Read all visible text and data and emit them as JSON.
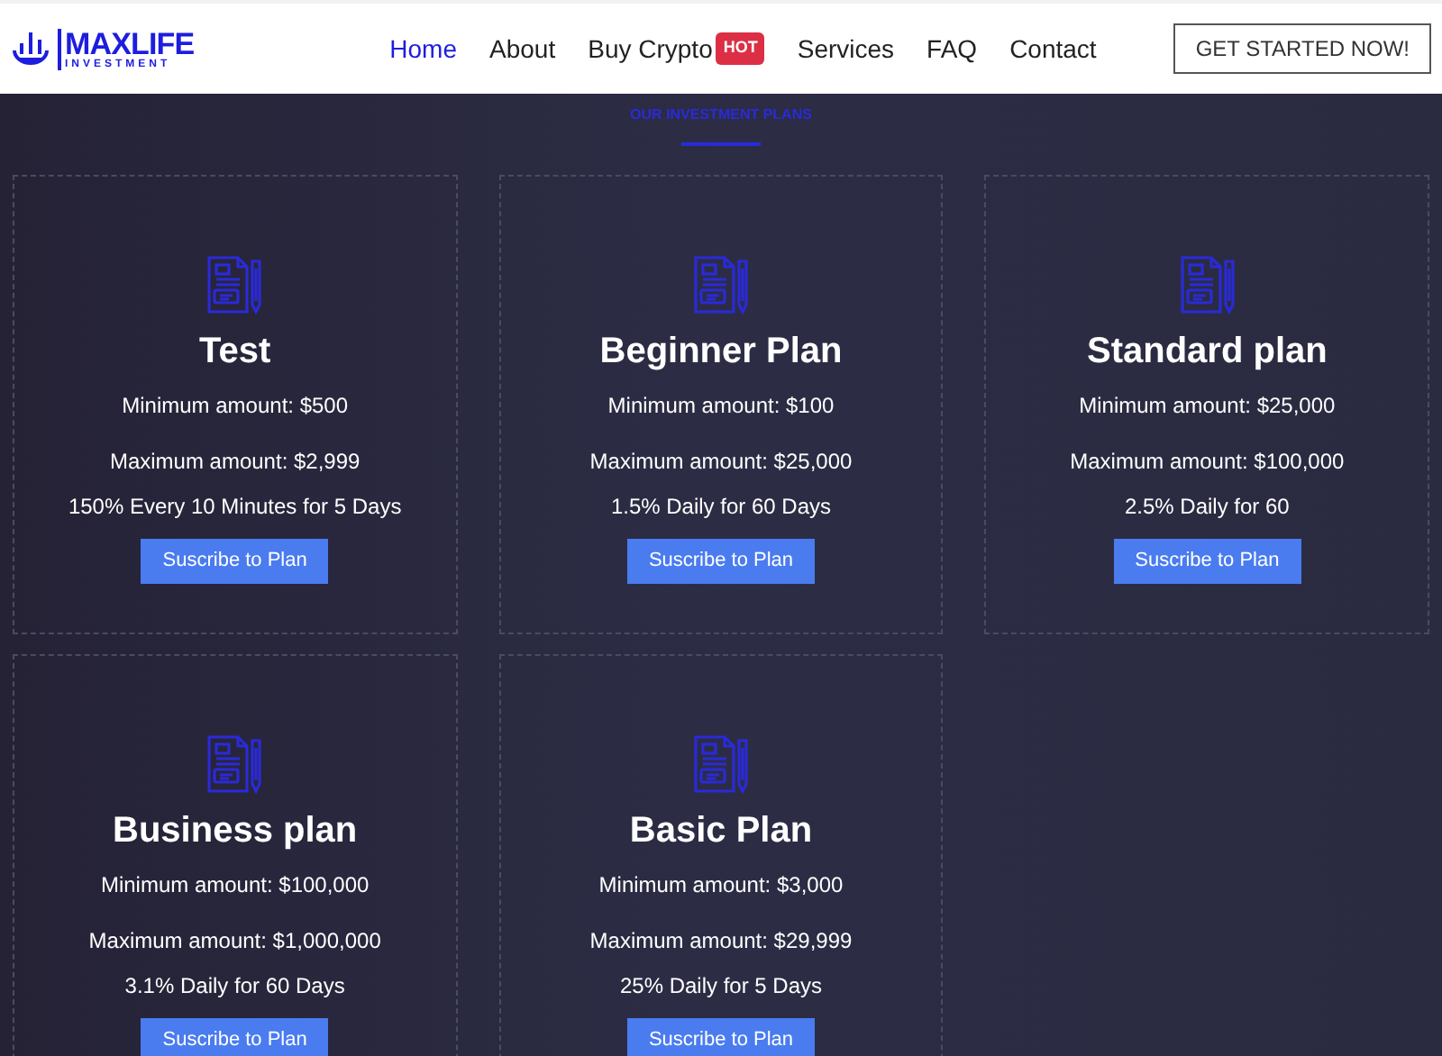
{
  "logo": {
    "name": "MAXLIFE",
    "tagline": "INVESTMENT"
  },
  "nav": [
    {
      "label": "Home",
      "selected": true
    },
    {
      "label": "About",
      "selected": false
    },
    {
      "label": "Buy Crypto",
      "selected": false,
      "badge": "HOT"
    },
    {
      "label": "Services",
      "selected": false
    },
    {
      "label": "FAQ",
      "selected": false
    },
    {
      "label": "Contact",
      "selected": false
    }
  ],
  "cta": "GET STARTED NOW!",
  "section_title": "OUR INVESTMENT PLANS",
  "plans": [
    {
      "name": "Test",
      "min": "Minimum amount: $500",
      "max": "Maximum amount: $2,999",
      "rate": "150% Every 10 Minutes for 5 Days",
      "button": "Suscribe to Plan"
    },
    {
      "name": "Beginner Plan",
      "min": "Minimum amount: $100",
      "max": "Maximum amount: $25,000",
      "rate": "1.5% Daily for 60 Days",
      "button": "Suscribe to Plan"
    },
    {
      "name": "Standard plan",
      "min": "Minimum amount: $25,000",
      "max": "Maximum amount: $100,000",
      "rate": "2.5% Daily for 60",
      "button": "Suscribe to Plan"
    },
    {
      "name": "Business plan",
      "min": "Minimum amount: $100,000",
      "max": "Maximum amount: $1,000,000",
      "rate": "3.1% Daily for 60 Days",
      "button": "Suscribe to Plan"
    },
    {
      "name": "Basic Plan",
      "min": "Minimum amount: $3,000",
      "max": "Maximum amount: $29,999",
      "rate": "25% Daily for 5 Days",
      "button": "Suscribe to Plan"
    }
  ]
}
